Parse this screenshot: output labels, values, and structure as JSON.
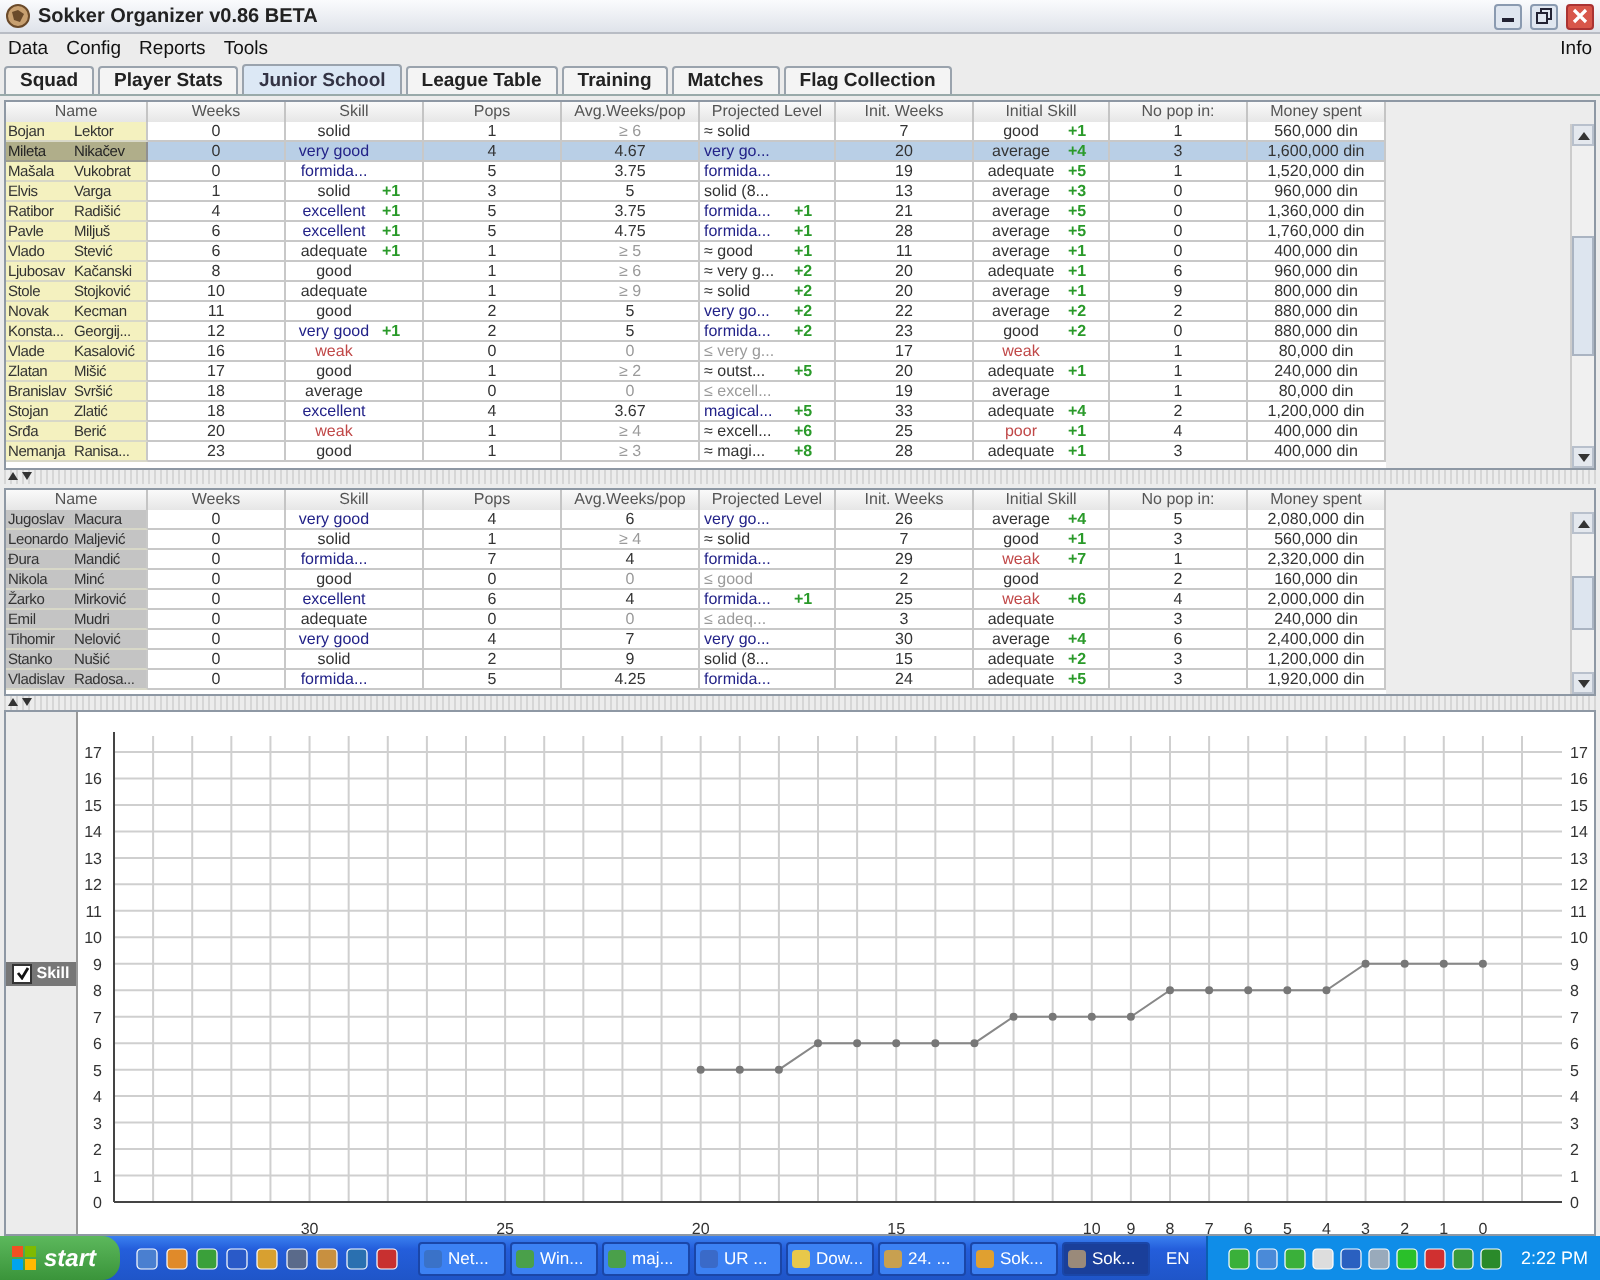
{
  "window": {
    "title": "Sokker Organizer v0.86 BETA"
  },
  "menu": {
    "items": [
      "Data",
      "Config",
      "Reports",
      "Tools"
    ],
    "right": "Info"
  },
  "tabs": [
    {
      "label": "Squad",
      "selected": false
    },
    {
      "label": "Player Stats",
      "selected": false
    },
    {
      "label": "Junior School",
      "selected": true
    },
    {
      "label": "League Table",
      "selected": false
    },
    {
      "label": "Training",
      "selected": false
    },
    {
      "label": "Matches",
      "selected": false
    },
    {
      "label": "Flag Collection",
      "selected": false
    }
  ],
  "top_table": {
    "color": "#f4f1bf",
    "columns": [
      "Name",
      "Weeks",
      "Skill",
      "Pops",
      "Avg.Weeks/pop",
      "Projected Level",
      "Init. Weeks",
      "Initial Skill",
      "No pop in:",
      "Money spent"
    ],
    "rows": [
      {
        "first": "Bojan",
        "last": "Lektor",
        "selected": false,
        "weeks": "0",
        "skill": {
          "text": "solid",
          "color": "#333333"
        },
        "pops": "1",
        "avg": {
          "text": "≥ 6",
          "color": "#9a9a9a"
        },
        "projected": {
          "text": "≈ solid",
          "color": "#333333"
        },
        "init_weeks": "7",
        "initial_skill": {
          "text": "good",
          "color": "#333333",
          "bonus": "+1"
        },
        "no_pop": "1",
        "money": "560,000 din"
      },
      {
        "first": "Mileta",
        "last": "Nikačev",
        "selected": true,
        "weeks": "0",
        "skill": {
          "text": "very good",
          "color": "#222288"
        },
        "pops": "4",
        "avg": {
          "text": "4.67",
          "color": "#333333"
        },
        "projected": {
          "text": "very go...",
          "color": "#222288"
        },
        "init_weeks": "20",
        "initial_skill": {
          "text": "average",
          "color": "#333333",
          "bonus": "+4"
        },
        "no_pop": "3",
        "money": "1,600,000 din"
      },
      {
        "first": "Mašala",
        "last": "Vukobrat",
        "selected": false,
        "weeks": "0",
        "skill": {
          "text": "formida...",
          "color": "#222288"
        },
        "pops": "5",
        "avg": {
          "text": "3.75",
          "color": "#333333"
        },
        "projected": {
          "text": "formida...",
          "color": "#222288"
        },
        "init_weeks": "19",
        "initial_skill": {
          "text": "adequate",
          "color": "#333333",
          "bonus": "+5"
        },
        "no_pop": "1",
        "money": "1,520,000 din"
      },
      {
        "first": "Elvis",
        "last": "Varga",
        "selected": false,
        "weeks": "1",
        "skill": {
          "text": "solid",
          "color": "#333333",
          "bonus": "+1"
        },
        "pops": "3",
        "avg": {
          "text": "5",
          "color": "#333333"
        },
        "projected": {
          "text": "solid (8...",
          "color": "#333333"
        },
        "init_weeks": "13",
        "initial_skill": {
          "text": "average",
          "color": "#333333",
          "bonus": "+3"
        },
        "no_pop": "0",
        "money": "960,000 din"
      },
      {
        "first": "Ratibor",
        "last": "Radišić",
        "selected": false,
        "weeks": "4",
        "skill": {
          "text": "excellent",
          "color": "#222288",
          "bonus": "+1"
        },
        "pops": "5",
        "avg": {
          "text": "3.75",
          "color": "#333333"
        },
        "projected": {
          "text": "formida...",
          "color": "#222288",
          "bonus": "+1"
        },
        "init_weeks": "21",
        "initial_skill": {
          "text": "average",
          "color": "#333333",
          "bonus": "+5"
        },
        "no_pop": "0",
        "money": "1,360,000 din"
      },
      {
        "first": "Pavle",
        "last": "Miljuš",
        "selected": false,
        "weeks": "6",
        "skill": {
          "text": "excellent",
          "color": "#222288",
          "bonus": "+1"
        },
        "pops": "5",
        "avg": {
          "text": "4.75",
          "color": "#333333"
        },
        "projected": {
          "text": "formida...",
          "color": "#222288",
          "bonus": "+1"
        },
        "init_weeks": "28",
        "initial_skill": {
          "text": "average",
          "color": "#333333",
          "bonus": "+5"
        },
        "no_pop": "0",
        "money": "1,760,000 din"
      },
      {
        "first": "Vlado",
        "last": "Stević",
        "selected": false,
        "weeks": "6",
        "skill": {
          "text": "adequate",
          "color": "#333333",
          "bonus": "+1"
        },
        "pops": "1",
        "avg": {
          "text": "≥ 5",
          "color": "#9a9a9a"
        },
        "projected": {
          "text": "≈ good",
          "color": "#333333",
          "bonus": "+1"
        },
        "init_weeks": "11",
        "initial_skill": {
          "text": "average",
          "color": "#333333",
          "bonus": "+1"
        },
        "no_pop": "0",
        "money": "400,000 din"
      },
      {
        "first": "Ljubosav",
        "last": "Kačanski",
        "selected": false,
        "weeks": "8",
        "skill": {
          "text": "good",
          "color": "#333333"
        },
        "pops": "1",
        "avg": {
          "text": "≥ 6",
          "color": "#9a9a9a"
        },
        "projected": {
          "text": "≈ very g...",
          "color": "#333333",
          "bonus": "+2"
        },
        "init_weeks": "20",
        "initial_skill": {
          "text": "adequate",
          "color": "#333333",
          "bonus": "+1"
        },
        "no_pop": "6",
        "money": "960,000 din"
      },
      {
        "first": "Stole",
        "last": "Stojković",
        "selected": false,
        "weeks": "10",
        "skill": {
          "text": "adequate",
          "color": "#333333"
        },
        "pops": "1",
        "avg": {
          "text": "≥ 9",
          "color": "#9a9a9a"
        },
        "projected": {
          "text": "≈ solid",
          "color": "#333333",
          "bonus": "+2"
        },
        "init_weeks": "20",
        "initial_skill": {
          "text": "average",
          "color": "#333333",
          "bonus": "+1"
        },
        "no_pop": "9",
        "money": "800,000 din"
      },
      {
        "first": "Novak",
        "last": "Kecman",
        "selected": false,
        "weeks": "11",
        "skill": {
          "text": "good",
          "color": "#333333"
        },
        "pops": "2",
        "avg": {
          "text": "5",
          "color": "#333333"
        },
        "projected": {
          "text": "very go...",
          "color": "#222288",
          "bonus": "+2"
        },
        "init_weeks": "22",
        "initial_skill": {
          "text": "average",
          "color": "#333333",
          "bonus": "+2"
        },
        "no_pop": "2",
        "money": "880,000 din"
      },
      {
        "first": "Konsta...",
        "last": "Georgij...",
        "selected": false,
        "weeks": "12",
        "skill": {
          "text": "very good",
          "color": "#222288",
          "bonus": "+1"
        },
        "pops": "2",
        "avg": {
          "text": "5",
          "color": "#333333"
        },
        "projected": {
          "text": "formida...",
          "color": "#222288",
          "bonus": "+2"
        },
        "init_weeks": "23",
        "initial_skill": {
          "text": "good",
          "color": "#333333",
          "bonus": "+2"
        },
        "no_pop": "0",
        "money": "880,000 din"
      },
      {
        "first": "Vlade",
        "last": "Kasalović",
        "selected": false,
        "weeks": "16",
        "skill": {
          "text": "weak",
          "color": "#c04848"
        },
        "pops": "0",
        "avg": {
          "text": "0",
          "color": "#9a9a9a"
        },
        "projected": {
          "text": "≤ very g...",
          "color": "#9a9a9a"
        },
        "init_weeks": "17",
        "initial_skill": {
          "text": "weak",
          "color": "#c04848"
        },
        "no_pop": "1",
        "money": "80,000 din"
      },
      {
        "first": "Zlatan",
        "last": "Mišić",
        "selected": false,
        "weeks": "17",
        "skill": {
          "text": "good",
          "color": "#333333"
        },
        "pops": "1",
        "avg": {
          "text": "≥ 2",
          "color": "#9a9a9a"
        },
        "projected": {
          "text": "≈ outst...",
          "color": "#333333",
          "bonus": "+5"
        },
        "init_weeks": "20",
        "initial_skill": {
          "text": "adequate",
          "color": "#333333",
          "bonus": "+1"
        },
        "no_pop": "1",
        "money": "240,000 din"
      },
      {
        "first": "Branislav",
        "last": "Svršić",
        "selected": false,
        "weeks": "18",
        "skill": {
          "text": "average",
          "color": "#333333"
        },
        "pops": "0",
        "avg": {
          "text": "0",
          "color": "#9a9a9a"
        },
        "projected": {
          "text": "≤ excell...",
          "color": "#9a9a9a"
        },
        "init_weeks": "19",
        "initial_skill": {
          "text": "average",
          "color": "#333333"
        },
        "no_pop": "1",
        "money": "80,000 din"
      },
      {
        "first": "Stojan",
        "last": "Zlatić",
        "selected": false,
        "weeks": "18",
        "skill": {
          "text": "excellent",
          "color": "#222288"
        },
        "pops": "4",
        "avg": {
          "text": "3.67",
          "color": "#333333"
        },
        "projected": {
          "text": "magical...",
          "color": "#222288",
          "bonus": "+5"
        },
        "init_weeks": "33",
        "initial_skill": {
          "text": "adequate",
          "color": "#333333",
          "bonus": "+4"
        },
        "no_pop": "2",
        "money": "1,200,000 din"
      },
      {
        "first": "Srđa",
        "last": "Berić",
        "selected": false,
        "weeks": "20",
        "skill": {
          "text": "weak",
          "color": "#c04848"
        },
        "pops": "1",
        "avg": {
          "text": "≥ 4",
          "color": "#9a9a9a"
        },
        "projected": {
          "text": "≈ excell...",
          "color": "#333333",
          "bonus": "+6"
        },
        "init_weeks": "25",
        "initial_skill": {
          "text": "poor",
          "color": "#c04848",
          "bonus": "+1"
        },
        "no_pop": "4",
        "money": "400,000 din"
      },
      {
        "first": "Nemanja",
        "last": "Ranisa...",
        "selected": false,
        "weeks": "23",
        "skill": {
          "text": "good",
          "color": "#333333"
        },
        "pops": "1",
        "avg": {
          "text": "≥ 3",
          "color": "#9a9a9a"
        },
        "projected": {
          "text": "≈ magi...",
          "color": "#333333",
          "bonus": "+8"
        },
        "init_weeks": "28",
        "initial_skill": {
          "text": "adequate",
          "color": "#333333",
          "bonus": "+1"
        },
        "no_pop": "3",
        "money": "400,000 din"
      }
    ]
  },
  "bottom_table": {
    "color": "#c4c4c4",
    "columns": [
      "Name",
      "Weeks",
      "Skill",
      "Pops",
      "Avg.Weeks/pop",
      "Projected Level",
      "Init. Weeks",
      "Initial Skill",
      "No pop in:",
      "Money spent"
    ],
    "rows": [
      {
        "first": "Jugoslav",
        "last": "Macura",
        "selected": false,
        "weeks": "0",
        "skill": {
          "text": "very good",
          "color": "#222288"
        },
        "pops": "4",
        "avg": {
          "text": "6",
          "color": "#333333"
        },
        "projected": {
          "text": "very go...",
          "color": "#222288"
        },
        "init_weeks": "26",
        "initial_skill": {
          "text": "average",
          "color": "#333333",
          "bonus": "+4"
        },
        "no_pop": "5",
        "money": "2,080,000 din"
      },
      {
        "first": "Leonardo",
        "last": "Maljević",
        "selected": false,
        "weeks": "0",
        "skill": {
          "text": "solid",
          "color": "#333333"
        },
        "pops": "1",
        "avg": {
          "text": "≥ 4",
          "color": "#9a9a9a"
        },
        "projected": {
          "text": "≈ solid",
          "color": "#333333"
        },
        "init_weeks": "7",
        "initial_skill": {
          "text": "good",
          "color": "#333333",
          "bonus": "+1"
        },
        "no_pop": "3",
        "money": "560,000 din"
      },
      {
        "first": "Đura",
        "last": "Mandić",
        "selected": false,
        "weeks": "0",
        "skill": {
          "text": "formida...",
          "color": "#222288"
        },
        "pops": "7",
        "avg": {
          "text": "4",
          "color": "#333333"
        },
        "projected": {
          "text": "formida...",
          "color": "#222288"
        },
        "init_weeks": "29",
        "initial_skill": {
          "text": "weak",
          "color": "#c04848",
          "bonus": "+7"
        },
        "no_pop": "1",
        "money": "2,320,000 din"
      },
      {
        "first": "Nikola",
        "last": "Minć",
        "selected": false,
        "weeks": "0",
        "skill": {
          "text": "good",
          "color": "#333333"
        },
        "pops": "0",
        "avg": {
          "text": "0",
          "color": "#9a9a9a"
        },
        "projected": {
          "text": "≤ good",
          "color": "#9a9a9a"
        },
        "init_weeks": "2",
        "initial_skill": {
          "text": "good",
          "color": "#333333"
        },
        "no_pop": "2",
        "money": "160,000 din"
      },
      {
        "first": "Žarko",
        "last": "Mirković",
        "selected": false,
        "weeks": "0",
        "skill": {
          "text": "excellent",
          "color": "#222288"
        },
        "pops": "6",
        "avg": {
          "text": "4",
          "color": "#333333"
        },
        "projected": {
          "text": "formida...",
          "color": "#222288",
          "bonus": "+1"
        },
        "init_weeks": "25",
        "initial_skill": {
          "text": "weak",
          "color": "#c04848",
          "bonus": "+6"
        },
        "no_pop": "4",
        "money": "2,000,000 din"
      },
      {
        "first": "Emil",
        "last": "Mudri",
        "selected": false,
        "weeks": "0",
        "skill": {
          "text": "adequate",
          "color": "#333333"
        },
        "pops": "0",
        "avg": {
          "text": "0",
          "color": "#9a9a9a"
        },
        "projected": {
          "text": "≤ adeq...",
          "color": "#9a9a9a"
        },
        "init_weeks": "3",
        "initial_skill": {
          "text": "adequate",
          "color": "#333333"
        },
        "no_pop": "3",
        "money": "240,000 din"
      },
      {
        "first": "Tihomir",
        "last": "Nelović",
        "selected": false,
        "weeks": "0",
        "skill": {
          "text": "very good",
          "color": "#222288"
        },
        "pops": "4",
        "avg": {
          "text": "7",
          "color": "#333333"
        },
        "projected": {
          "text": "very go...",
          "color": "#222288"
        },
        "init_weeks": "30",
        "initial_skill": {
          "text": "average",
          "color": "#333333",
          "bonus": "+4"
        },
        "no_pop": "6",
        "money": "2,400,000 din"
      },
      {
        "first": "Stanko",
        "last": "Nušić",
        "selected": false,
        "weeks": "0",
        "skill": {
          "text": "solid",
          "color": "#333333"
        },
        "pops": "2",
        "avg": {
          "text": "9",
          "color": "#333333"
        },
        "projected": {
          "text": "solid (8...",
          "color": "#333333"
        },
        "init_weeks": "15",
        "initial_skill": {
          "text": "adequate",
          "color": "#333333",
          "bonus": "+2"
        },
        "no_pop": "3",
        "money": "1,200,000 din"
      },
      {
        "first": "Vladislav",
        "last": "Radosa...",
        "selected": false,
        "weeks": "0",
        "skill": {
          "text": "formida...",
          "color": "#222288"
        },
        "pops": "5",
        "avg": {
          "text": "4.25",
          "color": "#333333"
        },
        "projected": {
          "text": "formida...",
          "color": "#222288"
        },
        "init_weeks": "24",
        "initial_skill": {
          "text": "adequate",
          "color": "#333333",
          "bonus": "+5"
        },
        "no_pop": "3",
        "money": "1,920,000 din"
      }
    ]
  },
  "chart_panel": {
    "legend": [
      {
        "checked": true
      }
    ],
    "right_axis_labels": [
      "17",
      "16",
      "15",
      "14",
      "13",
      "12",
      "11",
      "10",
      "9",
      "8",
      "7",
      "6",
      "5",
      "4",
      "3",
      "2",
      "1",
      "0"
    ],
    "chart_data": {
      "type": "line",
      "x": [
        20,
        19,
        18,
        17,
        16,
        15,
        14,
        13,
        12,
        11,
        10,
        9,
        8,
        7,
        6,
        5,
        4,
        3,
        2,
        1,
        0
      ],
      "series": [
        {
          "name": "Skill",
          "color": "#888888",
          "marker": "circle",
          "values": [
            5,
            5,
            5,
            6,
            6,
            6,
            6,
            6,
            7,
            7,
            7,
            7,
            8,
            8,
            8,
            8,
            8,
            9,
            9,
            9,
            9
          ]
        }
      ],
      "xlim": [
        35,
        -1
      ],
      "ylim": [
        0,
        17
      ],
      "grid": true,
      "xticks": [
        30,
        25,
        20,
        15,
        10,
        9,
        8,
        7,
        6,
        5,
        4,
        3,
        2,
        1,
        0
      ],
      "yticks": [
        0,
        1,
        2,
        3,
        4,
        5,
        6,
        7,
        8,
        9,
        10,
        11,
        12,
        13,
        14,
        15,
        16,
        17
      ]
    }
  },
  "taskbar": {
    "start": "start",
    "tasks": [
      {
        "label": "Net...",
        "selected": false
      },
      {
        "label": "Win...",
        "selected": false
      },
      {
        "label": "maj...",
        "selected": false
      },
      {
        "label": "UR ...",
        "selected": false
      },
      {
        "label": "Dow...",
        "selected": false
      },
      {
        "label": "24. ...",
        "selected": false
      },
      {
        "label": "Sok...",
        "selected": false
      },
      {
        "label": "Sok...",
        "selected": true
      }
    ],
    "language": "EN",
    "clock": "2:22 PM"
  }
}
